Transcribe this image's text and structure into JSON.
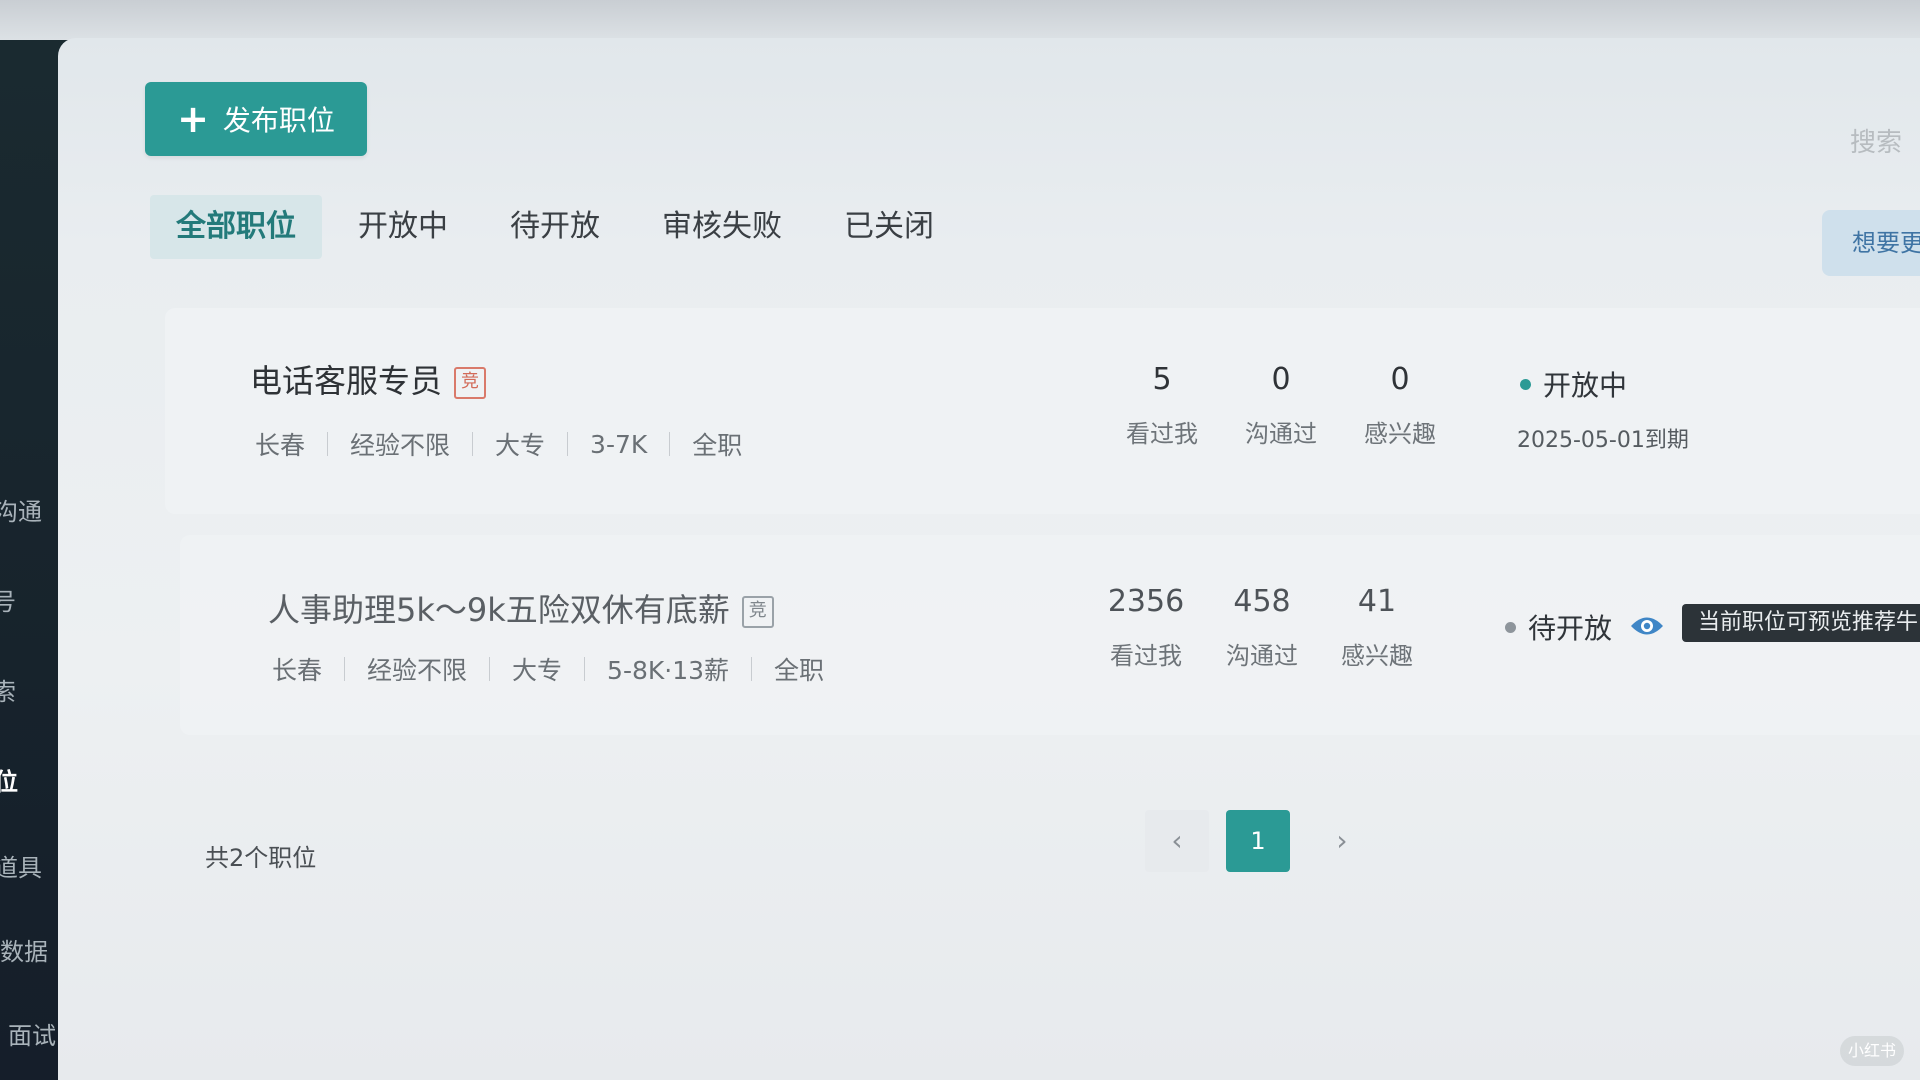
{
  "sidebar": {
    "items": [
      {
        "label": "沟通",
        "active": false
      },
      {
        "label": "号",
        "active": false
      },
      {
        "label": "索",
        "active": false
      },
      {
        "label": "位",
        "active": true
      },
      {
        "label": "道具",
        "active": false
      },
      {
        "label": "数据",
        "active": false
      },
      {
        "label": "面试",
        "active": false
      }
    ]
  },
  "toolbar": {
    "publish_label": "发布职位",
    "search_label": "搜索",
    "promo_label": "想要更"
  },
  "tabs": [
    {
      "label": "全部职位",
      "active": true
    },
    {
      "label": "开放中",
      "active": false
    },
    {
      "label": "待开放",
      "active": false
    },
    {
      "label": "审核失败",
      "active": false
    },
    {
      "label": "已关闭",
      "active": false
    }
  ],
  "jobs": [
    {
      "title": "电话客服专员",
      "badge": "竞",
      "meta": [
        "长春",
        "经验不限",
        "大专",
        "3-7K",
        "全职"
      ],
      "stats": [
        {
          "value": "5",
          "label": "看过我"
        },
        {
          "value": "0",
          "label": "沟通过"
        },
        {
          "value": "0",
          "label": "感兴趣"
        }
      ],
      "status": "开放中",
      "status_color": "#2b9a95",
      "expire": "2025-05-01到期"
    },
    {
      "title": "人事助理5k～9k五险双休有底薪",
      "badge": "竞",
      "meta": [
        "长春",
        "经验不限",
        "大专",
        "5-8K·13薪",
        "全职"
      ],
      "stats": [
        {
          "value": "2356",
          "label": "看过我"
        },
        {
          "value": "458",
          "label": "沟通过"
        },
        {
          "value": "41",
          "label": "感兴趣"
        }
      ],
      "status": "待开放",
      "status_color": "#8e959b",
      "tooltip": "当前职位可预览推荐牛"
    }
  ],
  "pagination": {
    "total_text": "共2个职位",
    "current_page": "1",
    "prev": "‹",
    "next": "›"
  },
  "colors": {
    "accent": "#2b9a95",
    "sidebar_bg": "#17232c",
    "eye_icon": "#3f86c6"
  },
  "watermark": "小红书"
}
